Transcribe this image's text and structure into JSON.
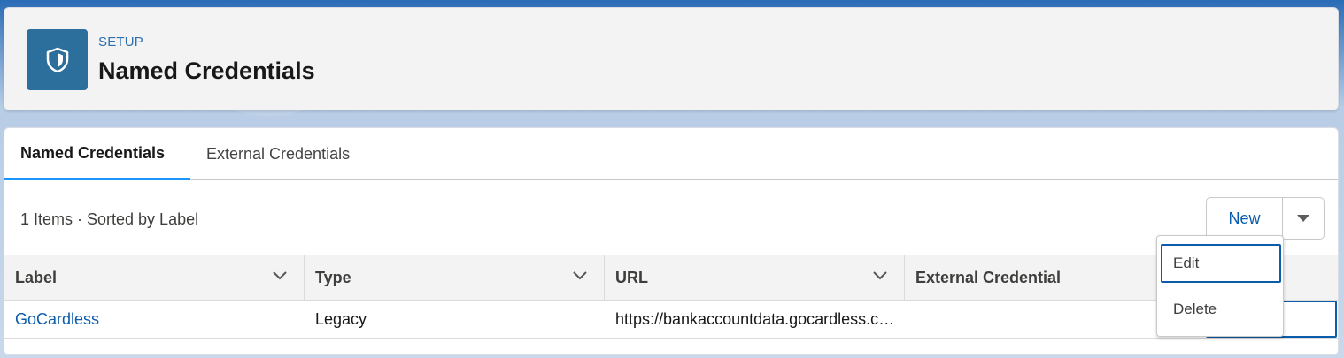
{
  "header": {
    "eyebrow": "SETUP",
    "title": "Named Credentials",
    "icon": "shield-icon",
    "icon_color": "#2c6f9c"
  },
  "tabs": [
    {
      "label": "Named Credentials",
      "active": true
    },
    {
      "label": "External Credentials",
      "active": false
    }
  ],
  "list": {
    "summary": "1 Items · Sorted by Label"
  },
  "actions": {
    "new_label": "New",
    "menu_icon": "caret-down-icon",
    "menu_items": [
      "Edit",
      "Delete"
    ]
  },
  "table": {
    "columns": [
      "Label",
      "Type",
      "URL",
      "External Credential"
    ],
    "rows": [
      {
        "label": "GoCardless",
        "type": "Legacy",
        "url": "https://bankaccountdata.gocardless.com",
        "external_credential": ""
      }
    ]
  },
  "colors": {
    "accent": "#1b96ff",
    "link": "#0b5cab"
  }
}
